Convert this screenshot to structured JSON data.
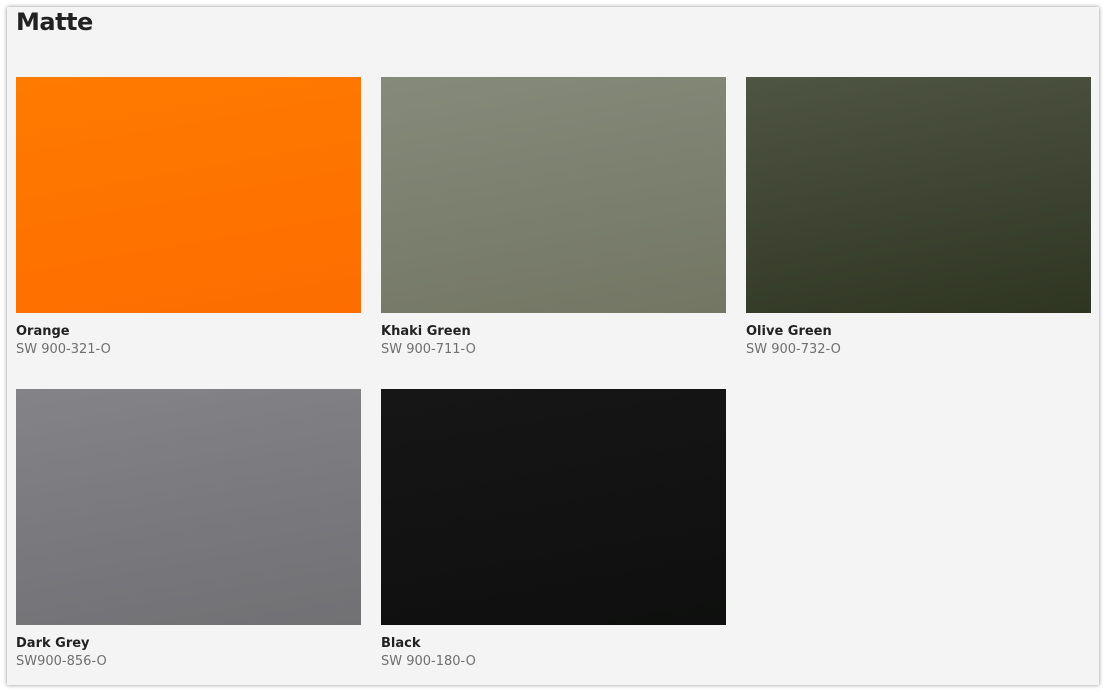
{
  "section": {
    "title": "Matte"
  },
  "swatches": [
    {
      "name": "Orange",
      "code": "SW 900-321-O",
      "color_top": "#ff7a00",
      "color_bottom": "#fd6d00"
    },
    {
      "name": "Khaki Green",
      "code": "SW 900-711-O",
      "color_top": "#858a7a",
      "color_bottom": "#737663"
    },
    {
      "name": "Olive Green",
      "code": "SW 900-732-O",
      "color_top": "#4f5543",
      "color_bottom": "#2e3521"
    },
    {
      "name": "Dark Grey",
      "code": "SW900-856-O",
      "color_top": "#838388",
      "color_bottom": "#717174"
    },
    {
      "name": "Black",
      "code": "SW 900-180-O",
      "color_top": "#161616",
      "color_bottom": "#0e0f0e"
    }
  ]
}
